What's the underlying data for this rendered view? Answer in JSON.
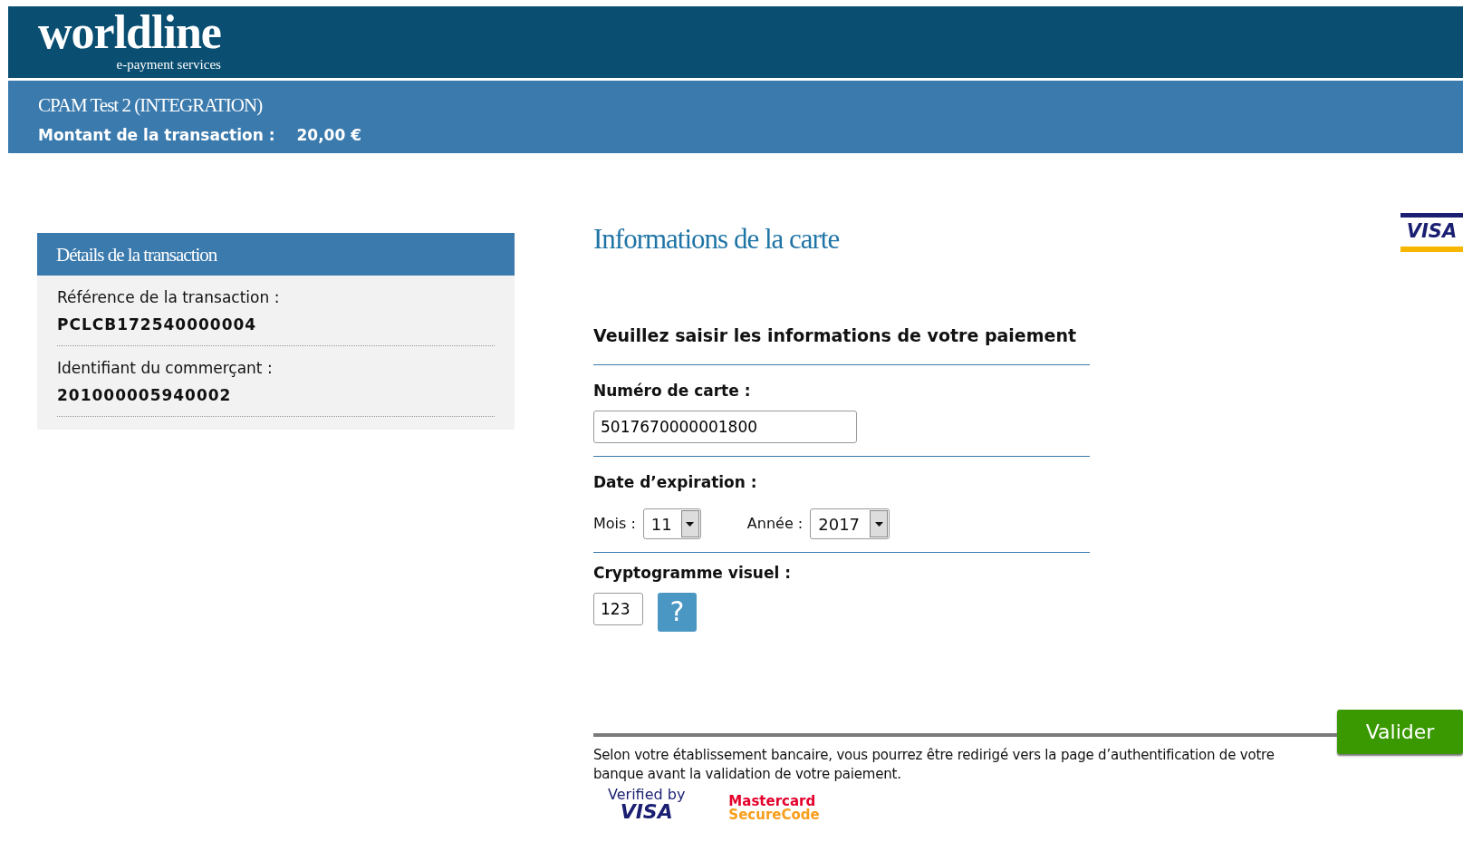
{
  "header": {
    "logo": "worldline",
    "tagline": "e-payment services"
  },
  "merchant_bar": {
    "merchant": "CPAM Test 2 (INTEGRATION)",
    "amount_label": "Montant de la transaction :",
    "amount": "20,00 €"
  },
  "details": {
    "title": "Détails de la transaction",
    "items": [
      {
        "label": "Référence de la transaction :",
        "value": "PCLCB172540000004"
      },
      {
        "label": "Identifiant du commerçant :",
        "value": "201000005940002"
      }
    ]
  },
  "card_form": {
    "title": "Informations de la carte",
    "card_brand": "VISA",
    "intro": "Veuillez saisir les informations de votre paiement",
    "card_number": {
      "label": "Numéro de carte :",
      "value": "5017670000001800"
    },
    "expiry": {
      "label": "Date d’expiration :",
      "month_label": "Mois :",
      "month": "11",
      "year_label": "Année :",
      "year": "2017"
    },
    "cvv": {
      "label": "Cryptogramme visuel :",
      "value": "123",
      "help": "?"
    },
    "submit": "Valider",
    "notice": "Selon votre établissement bancaire, vous pourrez être redirigé vers la page d’authentification de votre banque avant la validation de votre paiement.",
    "badges": [
      {
        "kind": "visa",
        "line1": "Verified by",
        "line2": "VISA"
      },
      {
        "kind": "mastercard",
        "line1": "Mastercard",
        "line2": "SecureCode"
      }
    ]
  }
}
